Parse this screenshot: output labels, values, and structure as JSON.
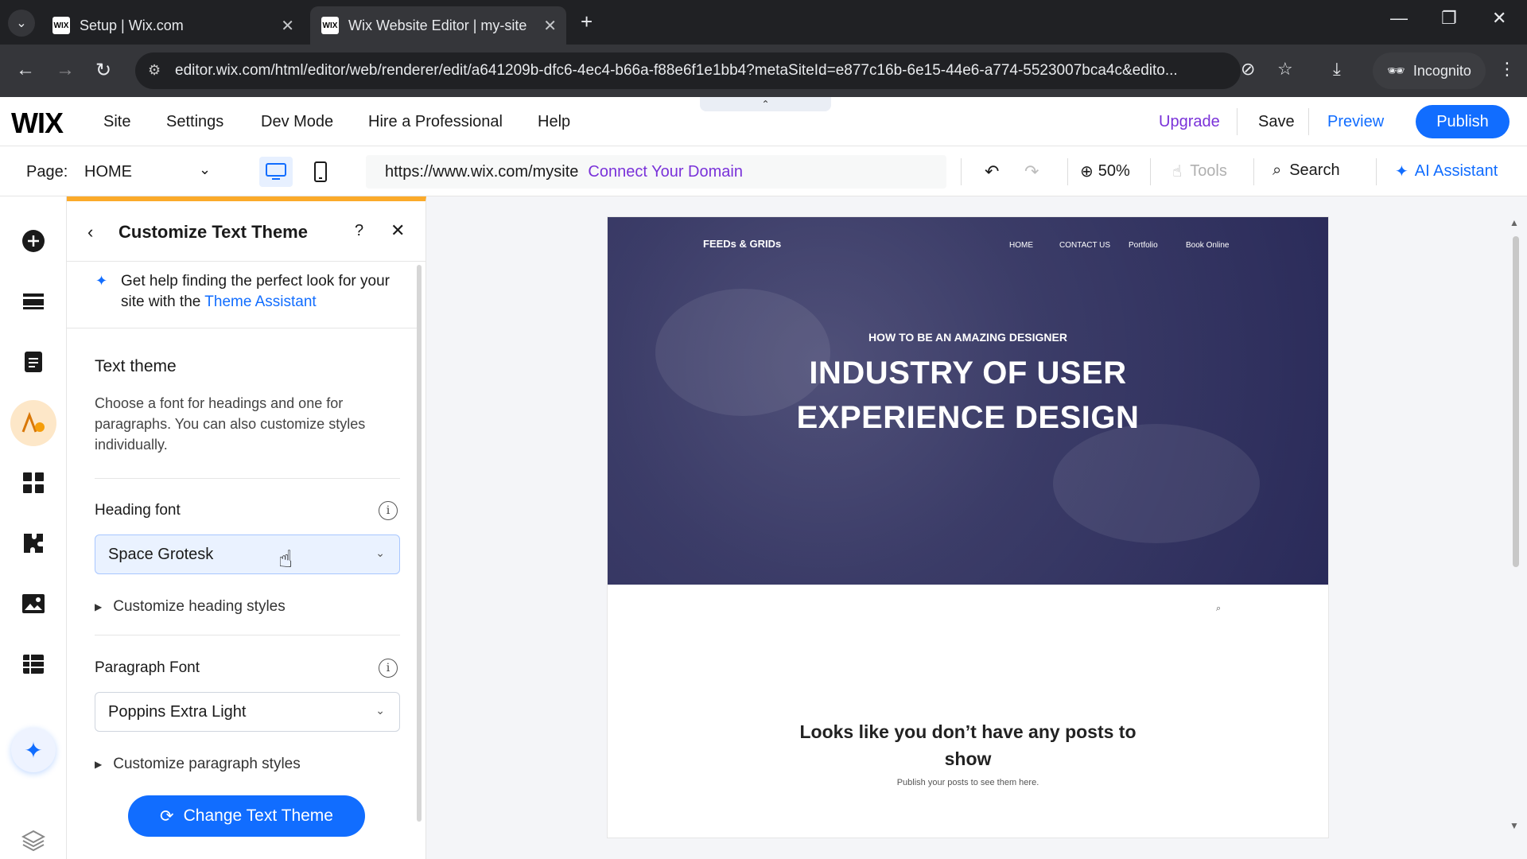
{
  "browser": {
    "tabs": [
      {
        "title": "Setup | Wix.com",
        "active": false
      },
      {
        "title": "Wix Website Editor | my-site",
        "active": true
      }
    ],
    "favicon_text": "WIX",
    "url": "editor.wix.com/html/editor/web/renderer/edit/a641209b-dfc6-4ec4-b66a-f88e6f1e1bb4?metaSiteId=e877c16b-6e15-44e6-a774-5523007bca4c&edito...",
    "incognito_label": "Incognito"
  },
  "wix_topbar": {
    "logo": "WIX",
    "menu": [
      "Site",
      "Settings",
      "Dev Mode",
      "Hire a Professional",
      "Help"
    ],
    "upgrade": "Upgrade",
    "save": "Save",
    "preview": "Preview",
    "publish": "Publish"
  },
  "pagebar": {
    "page_label": "Page:",
    "page_name": "HOME",
    "site_url": "https://www.wix.com/mysite",
    "connect_domain": "Connect Your Domain",
    "zoom": "50%",
    "tools": "Tools",
    "search": "Search",
    "ai_assistant": "AI Assistant"
  },
  "panel": {
    "title": "Customize Text Theme",
    "assistant_text": "Get help finding the perfect look for your site with the ",
    "assistant_link": "Theme Assistant",
    "section_title": "Text theme",
    "section_desc": "Choose a font for headings and one for paragraphs. You can also customize styles individually.",
    "heading_font_label": "Heading font",
    "heading_font_value": "Space Grotesk",
    "heading_styles": "Customize heading styles",
    "paragraph_font_label": "Paragraph Font",
    "paragraph_font_value": "Poppins Extra Light",
    "paragraph_styles": "Customize paragraph styles",
    "change_button": "Change Text Theme"
  },
  "site_preview": {
    "logo": "FEEDs & GRIDs",
    "nav": [
      "HOME",
      "CONTACT US",
      "Portfolio",
      "Book Online"
    ],
    "kicker": "HOW TO BE AN AMAZING DESIGNER",
    "title_line1": "INDUSTRY OF USER",
    "title_line2": "EXPERIENCE DESIGN",
    "empty_title_line1": "Looks like you don’t have any posts to",
    "empty_title_line2": "show",
    "empty_subtitle": "Publish your posts to see them here."
  },
  "colors": {
    "accent_blue": "#116dff",
    "upgrade_purple": "#7a32d9",
    "panel_top_orange": "#fbaa2a"
  }
}
